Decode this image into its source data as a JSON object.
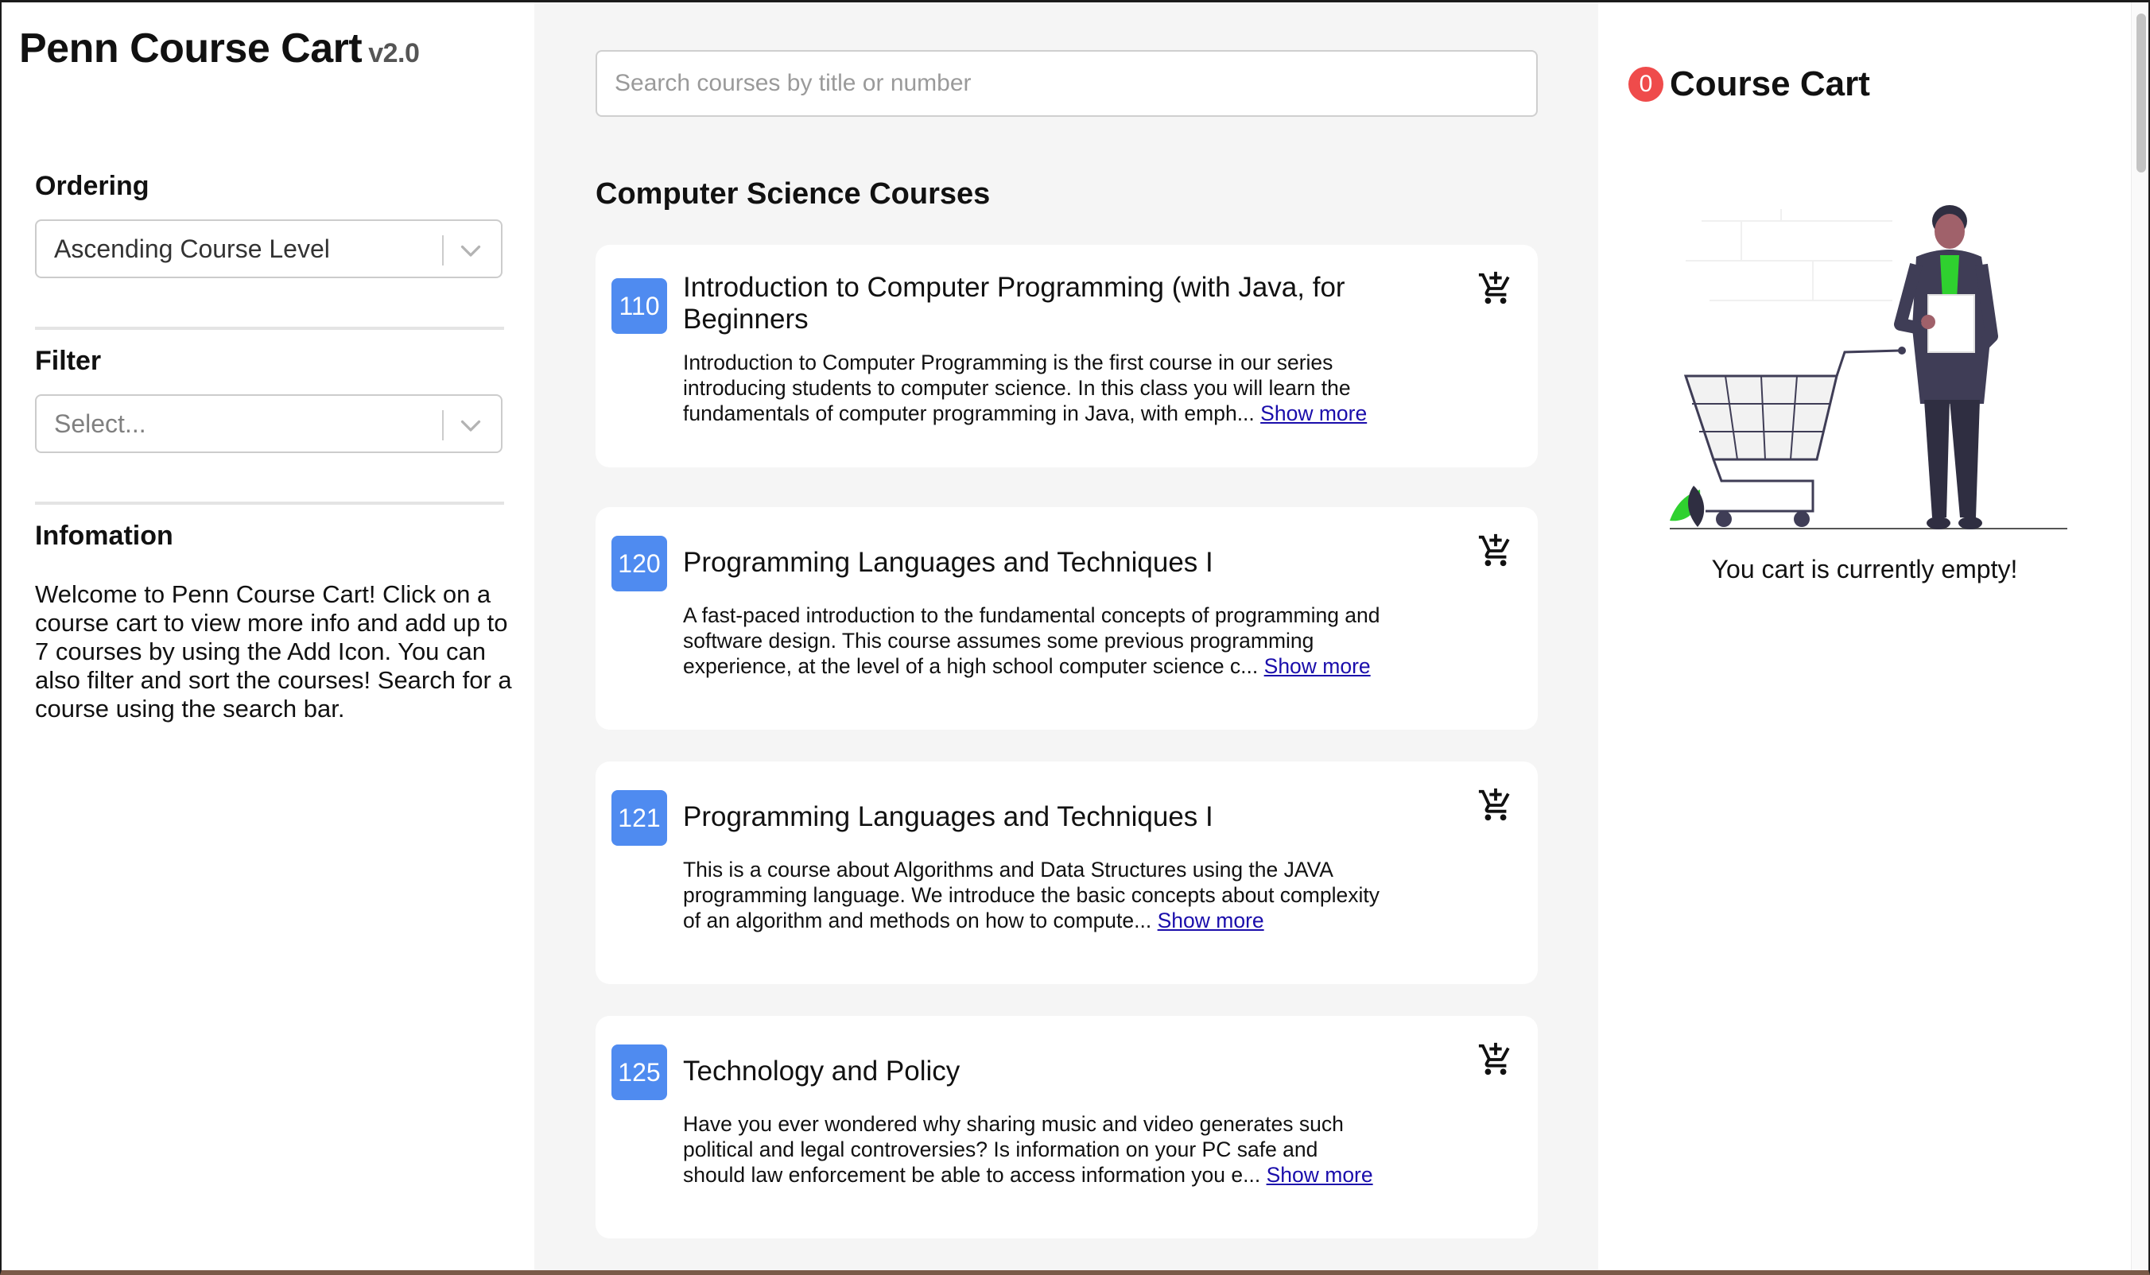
{
  "brand": {
    "title": "Penn Course Cart",
    "version": "v2.0"
  },
  "sidebar": {
    "ordering": {
      "label": "Ordering",
      "selected": "Ascending Course Level"
    },
    "filter": {
      "label": "Filter",
      "placeholder": "Select..."
    },
    "information": {
      "label": "Infomation",
      "text": "Welcome to Penn Course Cart! Click on a course cart to view more info and add up to 7 courses by using the Add Icon. You can also filter and sort the courses! Search for a course using the search bar."
    }
  },
  "search": {
    "placeholder": "Search courses by title or number",
    "value": ""
  },
  "main": {
    "heading": "Computer Science Courses",
    "show_more_label": "Show more",
    "courses": [
      {
        "number": "110",
        "title": "Introduction to Computer Programming (with Java, for Beginners",
        "description": "Introduction to Computer Programming is the first course in our series introducing students to computer science. In this class you will learn the fundamentals of computer programming in Java, with emph..."
      },
      {
        "number": "120",
        "title": "Programming Languages and Techniques I",
        "description": "A fast-paced introduction to the fundamental concepts of programming and software design. This course assumes some previous programming experience, at the level of a high school computer science c..."
      },
      {
        "number": "121",
        "title": "Programming Languages and Techniques I",
        "description": "This is a course about Algorithms and Data Structures using the JAVA programming language. We introduce the basic concepts about complexity of an algorithm and methods on how to compute..."
      },
      {
        "number": "125",
        "title": "Technology and Policy",
        "description": "Have you ever wondered why sharing music and video generates such political and legal controversies? Is information on your PC safe and should law enforcement be able to access information you e..."
      }
    ]
  },
  "cart": {
    "count": "0",
    "title": "Course Cart",
    "empty_message": "You cart is currently empty!"
  },
  "icons": {
    "add_to_cart": "add-shopping-cart-icon",
    "dropdown": "chevron-down-icon",
    "illustration": "shopping-cart-person-illustration"
  },
  "colors": {
    "badge": "#4f8bf0",
    "cart_count": "#ef4b4b",
    "link": "#1a0dab",
    "center_bg": "#f5f5f5"
  }
}
